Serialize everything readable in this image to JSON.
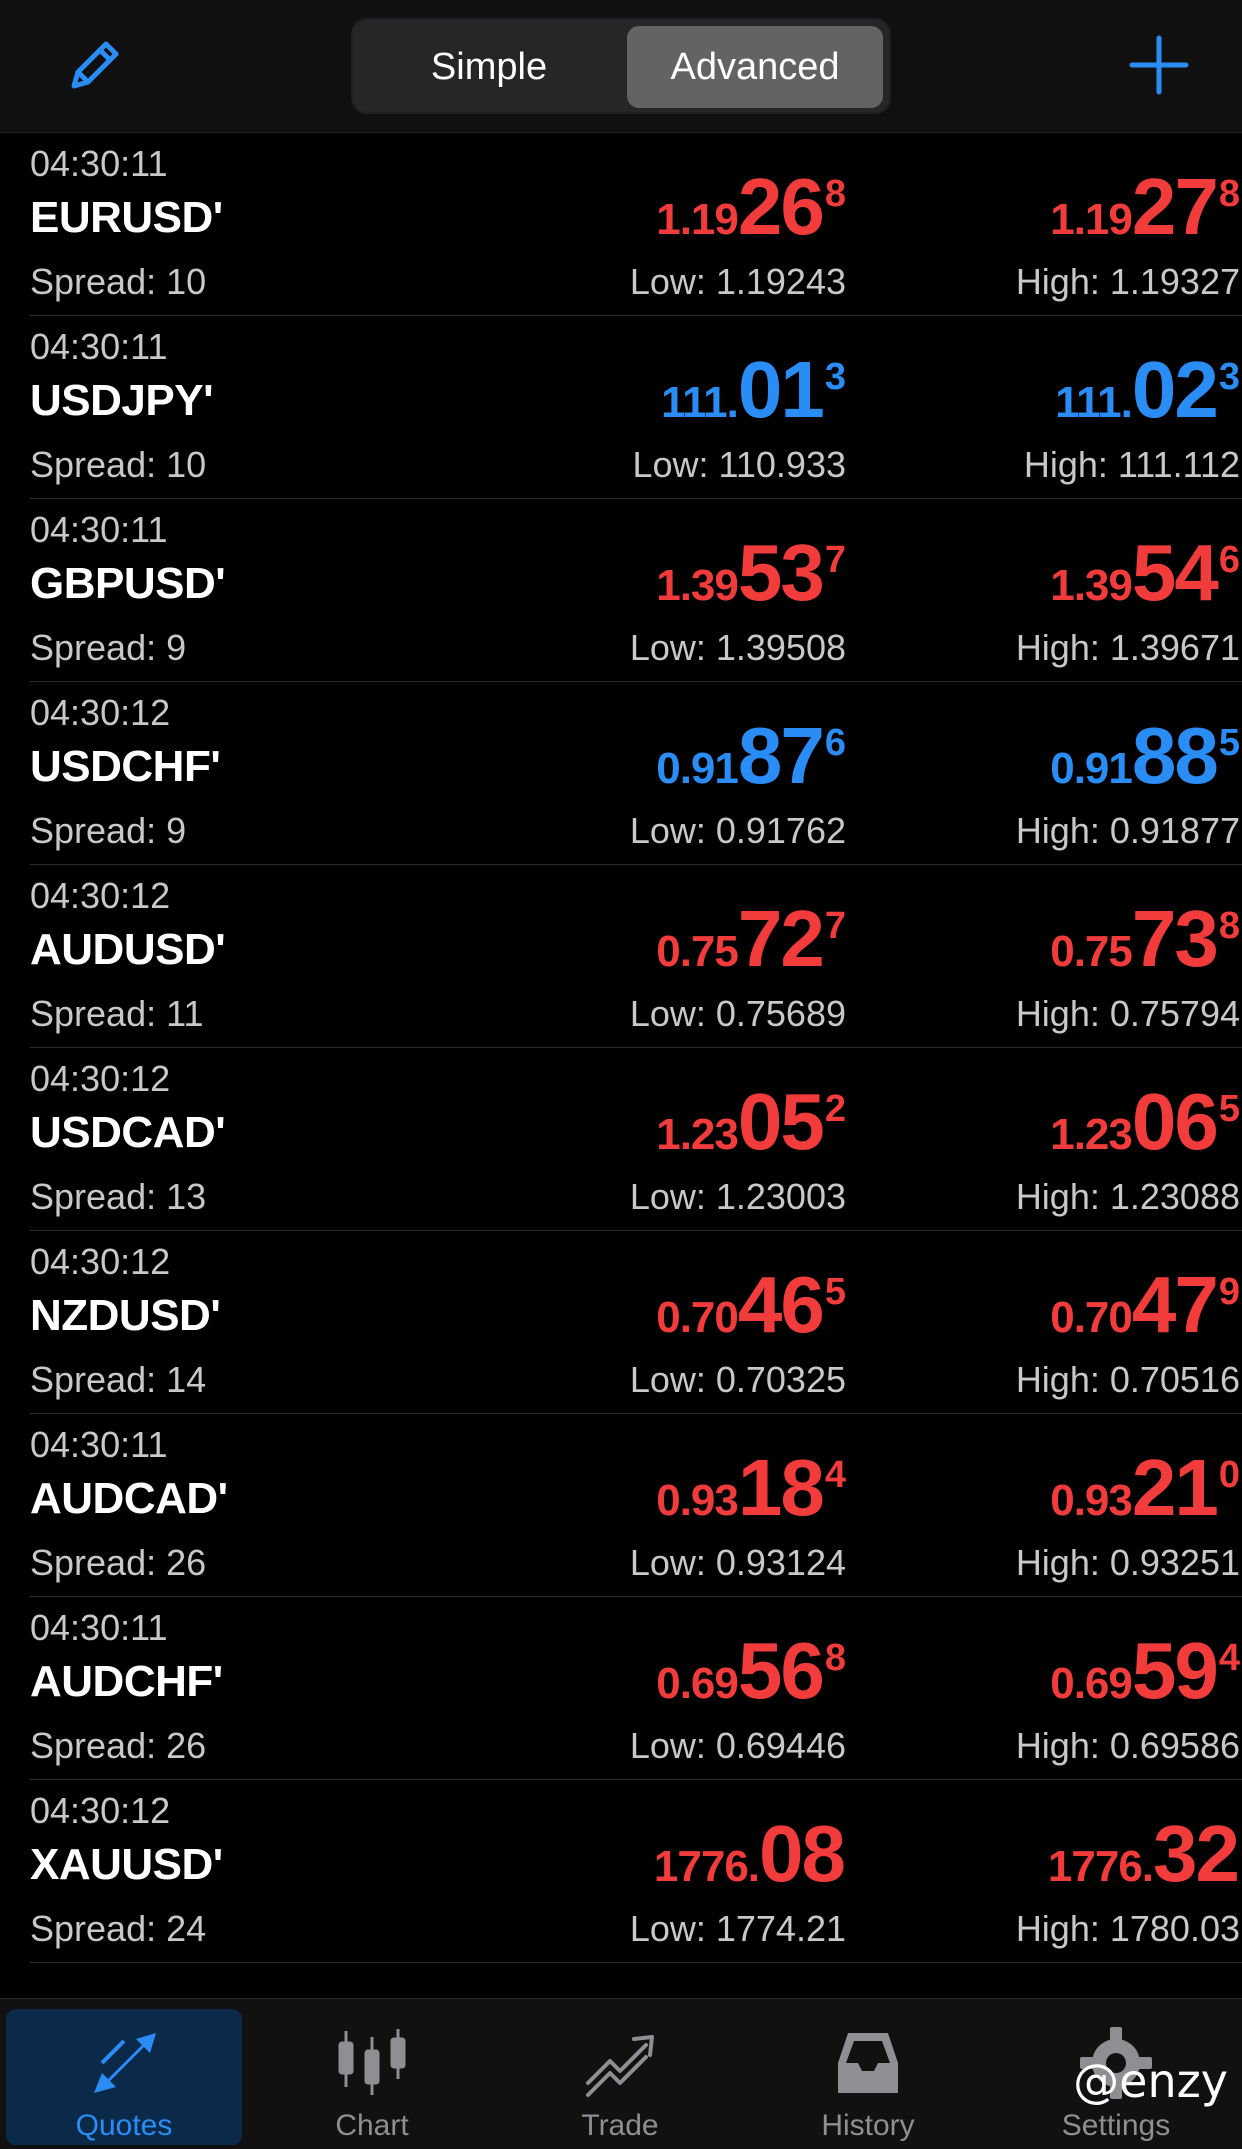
{
  "header": {
    "edit_icon": "pencil-icon",
    "add_icon": "plus-icon",
    "segments": [
      "Simple",
      "Advanced"
    ],
    "selected_segment": "Advanced",
    "accent": "#2a8cf5"
  },
  "colors": {
    "up": "#2a8cf5",
    "down": "#f23c3c"
  },
  "quotes": [
    {
      "time": "04:30:11",
      "symbol": "EURUSD'",
      "spread": "Spread: 10",
      "dir": "red",
      "bid": {
        "small": "1.19",
        "big": "26",
        "pip": "8"
      },
      "ask": {
        "small": "1.19",
        "big": "27",
        "pip": "8"
      },
      "low": "Low: 1.19243",
      "high": "High: 1.19327"
    },
    {
      "time": "04:30:11",
      "symbol": "USDJPY'",
      "spread": "Spread: 10",
      "dir": "blue",
      "bid": {
        "small": "111.",
        "big": "01",
        "pip": "3"
      },
      "ask": {
        "small": "111.",
        "big": "02",
        "pip": "3"
      },
      "low": "Low: 110.933",
      "high": "High: 111.112"
    },
    {
      "time": "04:30:11",
      "symbol": "GBPUSD'",
      "spread": "Spread: 9",
      "dir": "red",
      "bid": {
        "small": "1.39",
        "big": "53",
        "pip": "7"
      },
      "ask": {
        "small": "1.39",
        "big": "54",
        "pip": "6"
      },
      "low": "Low: 1.39508",
      "high": "High: 1.39671"
    },
    {
      "time": "04:30:12",
      "symbol": "USDCHF'",
      "spread": "Spread: 9",
      "dir": "blue",
      "bid": {
        "small": "0.91",
        "big": "87",
        "pip": "6"
      },
      "ask": {
        "small": "0.91",
        "big": "88",
        "pip": "5"
      },
      "low": "Low: 0.91762",
      "high": "High: 0.91877"
    },
    {
      "time": "04:30:12",
      "symbol": "AUDUSD'",
      "spread": "Spread: 11",
      "dir": "red",
      "bid": {
        "small": "0.75",
        "big": "72",
        "pip": "7"
      },
      "ask": {
        "small": "0.75",
        "big": "73",
        "pip": "8"
      },
      "low": "Low: 0.75689",
      "high": "High: 0.75794"
    },
    {
      "time": "04:30:12",
      "symbol": "USDCAD'",
      "spread": "Spread: 13",
      "dir": "red",
      "bid": {
        "small": "1.23",
        "big": "05",
        "pip": "2"
      },
      "ask": {
        "small": "1.23",
        "big": "06",
        "pip": "5"
      },
      "low": "Low: 1.23003",
      "high": "High: 1.23088"
    },
    {
      "time": "04:30:12",
      "symbol": "NZDUSD'",
      "spread": "Spread: 14",
      "dir": "red",
      "bid": {
        "small": "0.70",
        "big": "46",
        "pip": "5"
      },
      "ask": {
        "small": "0.70",
        "big": "47",
        "pip": "9"
      },
      "low": "Low: 0.70325",
      "high": "High: 0.70516"
    },
    {
      "time": "04:30:11",
      "symbol": "AUDCAD'",
      "spread": "Spread: 26",
      "dir": "red",
      "bid": {
        "small": "0.93",
        "big": "18",
        "pip": "4"
      },
      "ask": {
        "small": "0.93",
        "big": "21",
        "pip": "0"
      },
      "low": "Low: 0.93124",
      "high": "High: 0.93251"
    },
    {
      "time": "04:30:11",
      "symbol": "AUDCHF'",
      "spread": "Spread: 26",
      "dir": "red",
      "bid": {
        "small": "0.69",
        "big": "56",
        "pip": "8"
      },
      "ask": {
        "small": "0.69",
        "big": "59",
        "pip": "4"
      },
      "low": "Low: 0.69446",
      "high": "High: 0.69586"
    },
    {
      "time": "04:30:12",
      "symbol": "XAUUSD'",
      "spread": "Spread: 24",
      "dir": "red",
      "bid": {
        "small": "1776.",
        "big": "08",
        "pip": ""
      },
      "ask": {
        "small": "1776.",
        "big": "32",
        "pip": ""
      },
      "low": "Low: 1774.21",
      "high": "High: 1780.03"
    }
  ],
  "tabbar": {
    "tabs": [
      {
        "label": "Quotes",
        "icon": "quotes-arrows-icon",
        "active": true
      },
      {
        "label": "Chart",
        "icon": "candlestick-chart-icon",
        "active": false
      },
      {
        "label": "Trade",
        "icon": "trend-line-icon",
        "active": false
      },
      {
        "label": "History",
        "icon": "inbox-tray-icon",
        "active": false
      },
      {
        "label": "Settings",
        "icon": "gear-icon",
        "active": false
      }
    ]
  },
  "watermark": "@enzy"
}
